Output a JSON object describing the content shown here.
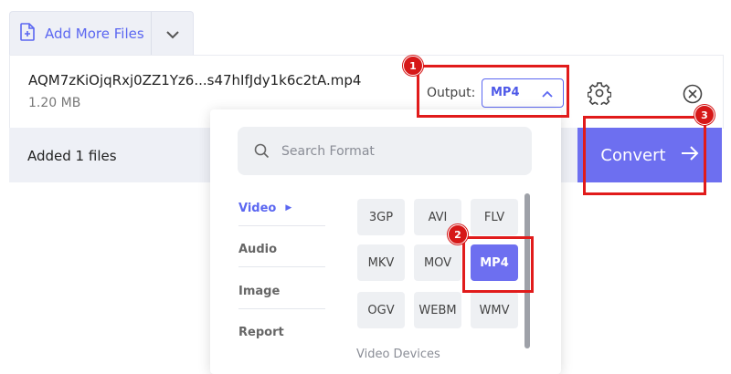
{
  "top_tab": {
    "add_more_files": "Add More Files"
  },
  "file": {
    "name": "AQM7zKiOjqRxj0ZZ1Yz6...s47hIfJdy1k6c2tA.mp4",
    "size": "1.20 MB",
    "output_label": "Output:",
    "output_value": "MP4"
  },
  "footer": {
    "added_text": "Added 1 files",
    "convert_label": "Convert"
  },
  "format_panel": {
    "search_placeholder": "Search Format",
    "categories": [
      {
        "label": "Video",
        "active": true
      },
      {
        "label": "Audio",
        "active": false
      },
      {
        "label": "Image",
        "active": false
      },
      {
        "label": "Report",
        "active": false
      }
    ],
    "formats": [
      {
        "label": "3GP",
        "selected": false
      },
      {
        "label": "AVI",
        "selected": false
      },
      {
        "label": "FLV",
        "selected": false
      },
      {
        "label": "MKV",
        "selected": false
      },
      {
        "label": "MOV",
        "selected": false
      },
      {
        "label": "MP4",
        "selected": true
      },
      {
        "label": "OGV",
        "selected": false
      },
      {
        "label": "WEBM",
        "selected": false
      },
      {
        "label": "WMV",
        "selected": false
      }
    ],
    "sub_heading": "Video Devices"
  },
  "annotations": {
    "badge_1": "1",
    "badge_2": "2",
    "badge_3": "3"
  },
  "colors": {
    "accent": "#5b67f1",
    "convert_bg": "#6d6ff0",
    "annotation_red": "#e11b1b"
  },
  "icons": [
    "add-file-icon",
    "chevron-down-icon",
    "chevron-up-icon",
    "gear-icon",
    "close-circle-icon",
    "search-icon",
    "arrow-right-icon"
  ]
}
